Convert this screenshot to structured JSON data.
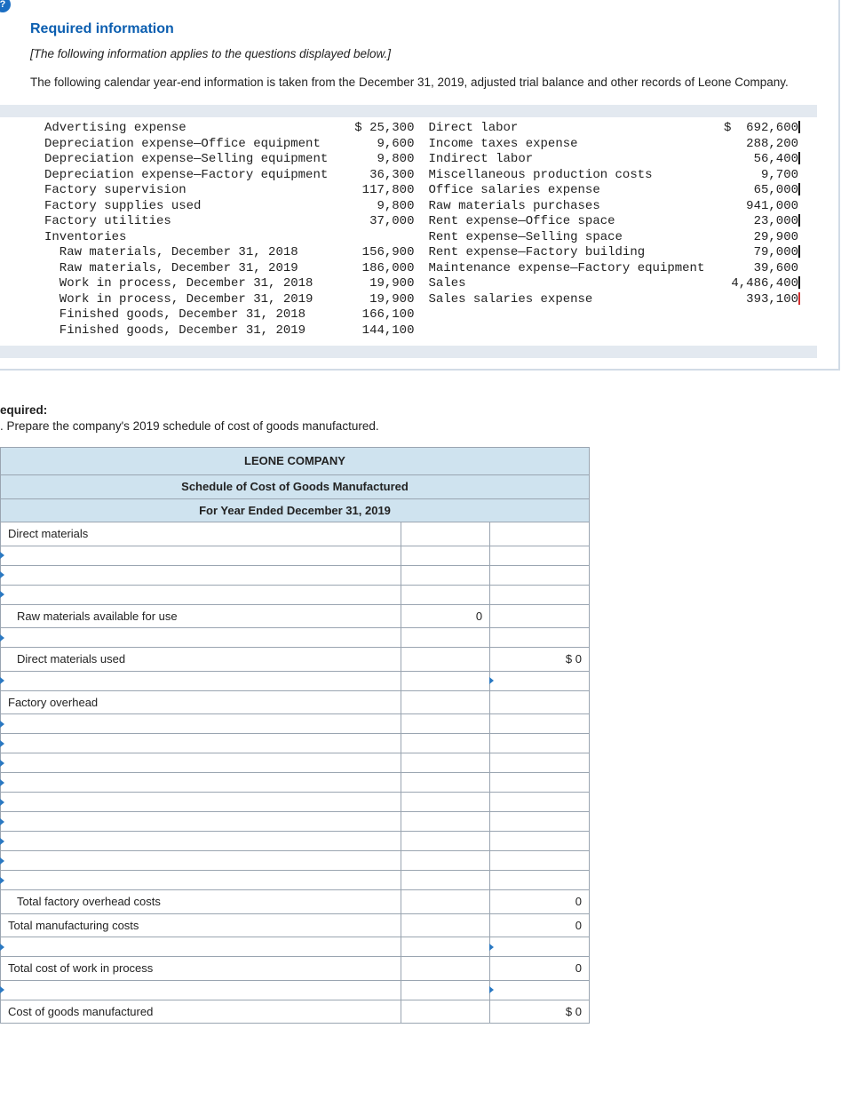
{
  "header": {
    "title": "Required information",
    "note": "[The following information applies to the questions displayed below.]",
    "intro": "The following calendar year-end information is taken from the December 31, 2019, adjusted trial balance and other records of Leone Company."
  },
  "trial_balance": {
    "left": [
      {
        "label": "Advertising expense",
        "value": "$ 25,300"
      },
      {
        "label": "Depreciation expense—Office equipment",
        "value": "9,600"
      },
      {
        "label": "Depreciation expense—Selling equipment",
        "value": "9,800"
      },
      {
        "label": "Depreciation expense—Factory equipment",
        "value": "36,300"
      },
      {
        "label": "Factory supervision",
        "value": "117,800"
      },
      {
        "label": "Factory supplies used",
        "value": "9,800"
      },
      {
        "label": "Factory utilities",
        "value": "37,000"
      },
      {
        "label": "Inventories",
        "value": ""
      },
      {
        "label": "  Raw materials, December 31, 2018",
        "value": "156,900"
      },
      {
        "label": "  Raw materials, December 31, 2019",
        "value": "186,000"
      },
      {
        "label": "  Work in process, December 31, 2018",
        "value": "19,900"
      },
      {
        "label": "  Work in process, December 31, 2019",
        "value": "19,900"
      },
      {
        "label": "  Finished goods, December 31, 2018",
        "value": "166,100"
      },
      {
        "label": "  Finished goods, December 31, 2019",
        "value": "144,100"
      }
    ],
    "right": [
      {
        "label": "Direct labor",
        "value": "$  692,600"
      },
      {
        "label": "Income taxes expense",
        "value": "288,200"
      },
      {
        "label": "Indirect labor",
        "value": "56,400"
      },
      {
        "label": "Miscellaneous production costs",
        "value": "9,700"
      },
      {
        "label": "Office salaries expense",
        "value": "65,000"
      },
      {
        "label": "Raw materials purchases",
        "value": "941,000"
      },
      {
        "label": "Rent expense—Office space",
        "value": "23,000"
      },
      {
        "label": "Rent expense—Selling space",
        "value": "29,900"
      },
      {
        "label": "Rent expense—Factory building",
        "value": "79,000"
      },
      {
        "label": "Maintenance expense—Factory equipment",
        "value": "39,600"
      },
      {
        "label": "Sales",
        "value": "4,486,400"
      },
      {
        "label": "Sales salaries expense",
        "value": "393,100"
      }
    ]
  },
  "required": {
    "heading": "equired:",
    "text": ". Prepare the company's 2019 schedule of cost of goods manufactured."
  },
  "schedule": {
    "title1": "LEONE COMPANY",
    "title2": "Schedule of Cost of Goods Manufactured",
    "title3": "For Year Ended December 31, 2019",
    "rows": [
      {
        "a": "Direct materials",
        "b": "",
        "c": "",
        "dd": false,
        "indent": 0
      },
      {
        "a": "",
        "b": "",
        "c": "",
        "dd": true,
        "indent": 0
      },
      {
        "a": "",
        "b": "",
        "c": "",
        "dd": true,
        "indent": 0
      },
      {
        "a": "",
        "b": "",
        "c": "",
        "dd": true,
        "indent": 0
      },
      {
        "a": "Raw materials available for use",
        "b": "0",
        "c": "",
        "dd": false,
        "indent": 1
      },
      {
        "a": "",
        "b": "",
        "c": "",
        "dd": true,
        "indent": 0
      },
      {
        "a": "Direct materials used",
        "b": "",
        "c": "$             0",
        "dd": false,
        "indent": 1
      },
      {
        "a": "",
        "b": "",
        "c": "",
        "dd": true,
        "indent": 0,
        "ddc": true
      },
      {
        "a": "Factory overhead",
        "b": "",
        "c": "",
        "dd": false,
        "indent": 0
      },
      {
        "a": "",
        "b": "",
        "c": "",
        "dd": true,
        "indent": 0
      },
      {
        "a": "",
        "b": "",
        "c": "",
        "dd": true,
        "indent": 0
      },
      {
        "a": "",
        "b": "",
        "c": "",
        "dd": true,
        "indent": 0
      },
      {
        "a": "",
        "b": "",
        "c": "",
        "dd": true,
        "indent": 0
      },
      {
        "a": "",
        "b": "",
        "c": "",
        "dd": true,
        "indent": 0
      },
      {
        "a": "",
        "b": "",
        "c": "",
        "dd": true,
        "indent": 0
      },
      {
        "a": "",
        "b": "",
        "c": "",
        "dd": true,
        "indent": 0
      },
      {
        "a": "",
        "b": "",
        "c": "",
        "dd": true,
        "indent": 0
      },
      {
        "a": "",
        "b": "",
        "c": "",
        "dd": true,
        "indent": 0
      },
      {
        "a": "Total factory overhead costs",
        "b": "",
        "c": "0",
        "dd": false,
        "indent": 1
      },
      {
        "a": "Total manufacturing costs",
        "b": "",
        "c": "0",
        "dd": false,
        "indent": 0
      },
      {
        "a": "",
        "b": "",
        "c": "",
        "dd": true,
        "indent": 0,
        "ddc": true
      },
      {
        "a": "Total cost of work in process",
        "b": "",
        "c": "0",
        "dd": false,
        "indent": 0
      },
      {
        "a": "",
        "b": "",
        "c": "",
        "dd": true,
        "indent": 0,
        "ddc": true
      },
      {
        "a": "Cost of goods manufactured",
        "b": "",
        "c": "$             0",
        "dd": false,
        "indent": 0
      }
    ]
  }
}
